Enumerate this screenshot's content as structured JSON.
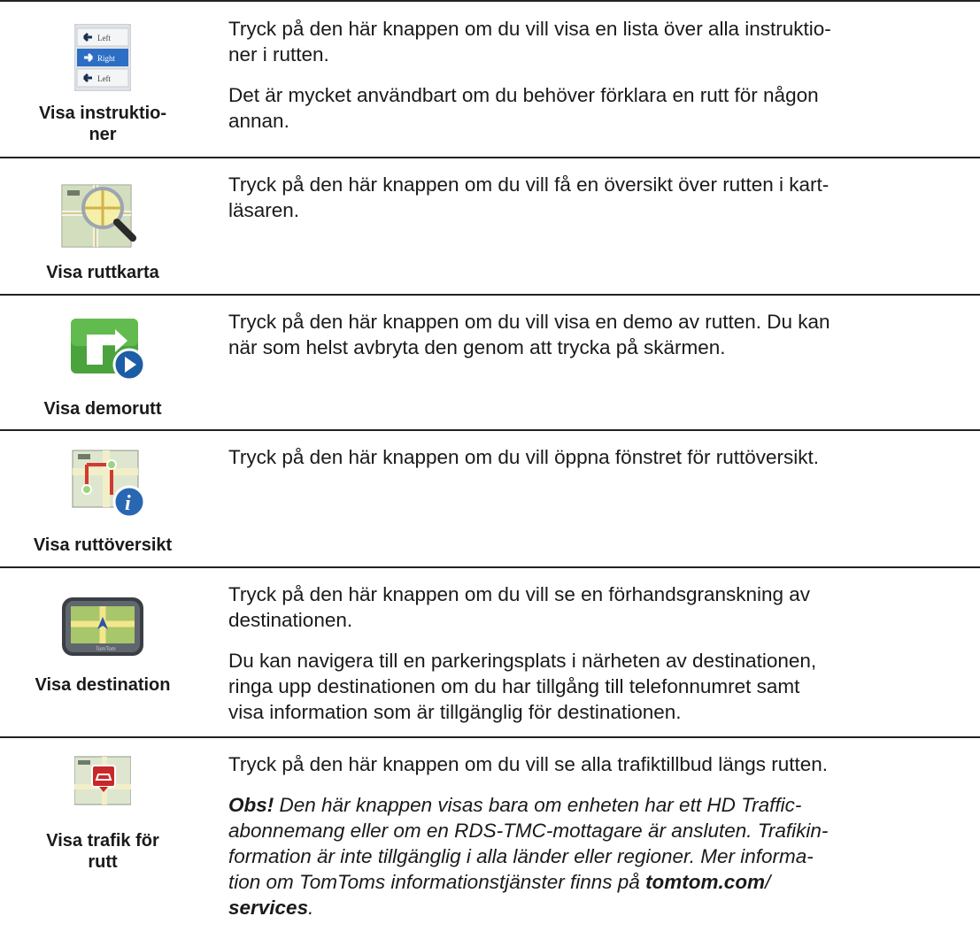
{
  "rows": [
    {
      "label": "Visa instruktio-\nner",
      "icon": "turn-instructions-icon",
      "p1": "Tryck på den här knappen om du vill visa en lista över alla instruktio-\nner i rutten.",
      "p2": "Det är mycket användbart om du behöver förklara en rutt för någon\nannan.",
      "icon_lines": [
        "Left",
        "Right",
        "Left"
      ]
    },
    {
      "label": "Visa ruttkarta",
      "icon": "map-magnifier-icon",
      "p1": "Tryck på den här knappen om du vill få en översikt över rutten i kart-\nläsaren."
    },
    {
      "label": "Visa demorutt",
      "icon": "route-demo-play-icon",
      "p1": "Tryck på den här knappen om du vill visa en demo av rutten. Du kan\nnär som helst avbryta den genom att trycka på skärmen."
    },
    {
      "label": "Visa ruttöversikt",
      "icon": "route-summary-info-icon",
      "p1": "Tryck på den här knappen om du vill öppna fönstret för ruttöversikt."
    },
    {
      "label": "Visa destination",
      "icon": "device-destination-icon",
      "p1": "Tryck på den här knappen om du vill se en förhandsgranskning av\ndestinationen.",
      "p2": "Du kan navigera till en parkeringsplats i närheten av destinationen,\nringa upp destinationen om du har tillgång till telefonnumret samt\nvisa information som är tillgänglig för destinationen.",
      "device_brand": "TomTom"
    },
    {
      "label": "Visa trafik för\nrutt",
      "icon": "traffic-incident-icon",
      "p1": "Tryck på den här knappen om du vill se alla trafiktillbud längs rutten.",
      "note_prefix": "Obs!",
      "note_text": " Den här knappen visas bara om enheten har ett HD Traffic-\nabonnemang eller om en RDS-TMC-mottagare är ansluten. Trafikin-\nformation är inte tillgänglig i alla länder eller regioner. Mer informa-\ntion om TomToms informationstjänster finns på ",
      "note_link1": "tomtom.com",
      "note_slash": "/",
      "note_link2": "services",
      "note_end": "."
    }
  ]
}
